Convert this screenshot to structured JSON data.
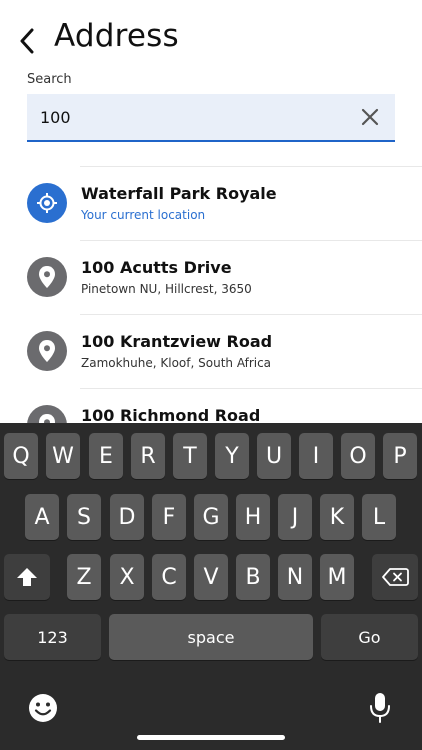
{
  "header": {
    "title": "Address"
  },
  "search": {
    "label": "Search",
    "value": "100"
  },
  "results": [
    {
      "title": "Waterfall Park Royale",
      "subtitle": "Your current location",
      "icon": "target-icon"
    },
    {
      "title": "100 Acutts Drive",
      "subtitle": "Pinetown NU, Hillcrest, 3650",
      "icon": "location-pin-icon"
    },
    {
      "title": "100 Krantzview Road",
      "subtitle": "Zamokhuhe, Kloof, South Africa",
      "icon": "location-pin-icon"
    },
    {
      "title": "100 Richmond Road",
      "subtitle": "",
      "icon": "location-pin-icon"
    }
  ],
  "keyboard": {
    "row1": [
      "Q",
      "W",
      "E",
      "R",
      "T",
      "Y",
      "U",
      "I",
      "O",
      "P"
    ],
    "row2": [
      "A",
      "S",
      "D",
      "F",
      "G",
      "H",
      "J",
      "K",
      "L"
    ],
    "row3": [
      "Z",
      "X",
      "C",
      "V",
      "B",
      "N",
      "M"
    ],
    "numbers_label": "123",
    "space_label": "space",
    "go_label": "Go"
  },
  "colors": {
    "accent": "#1f64c8",
    "current_location": "#2a6fd0",
    "pin_bg": "#6b6b6e",
    "keyboard_bg": "#2b2b2b",
    "key_bg": "#5a5a5a"
  }
}
